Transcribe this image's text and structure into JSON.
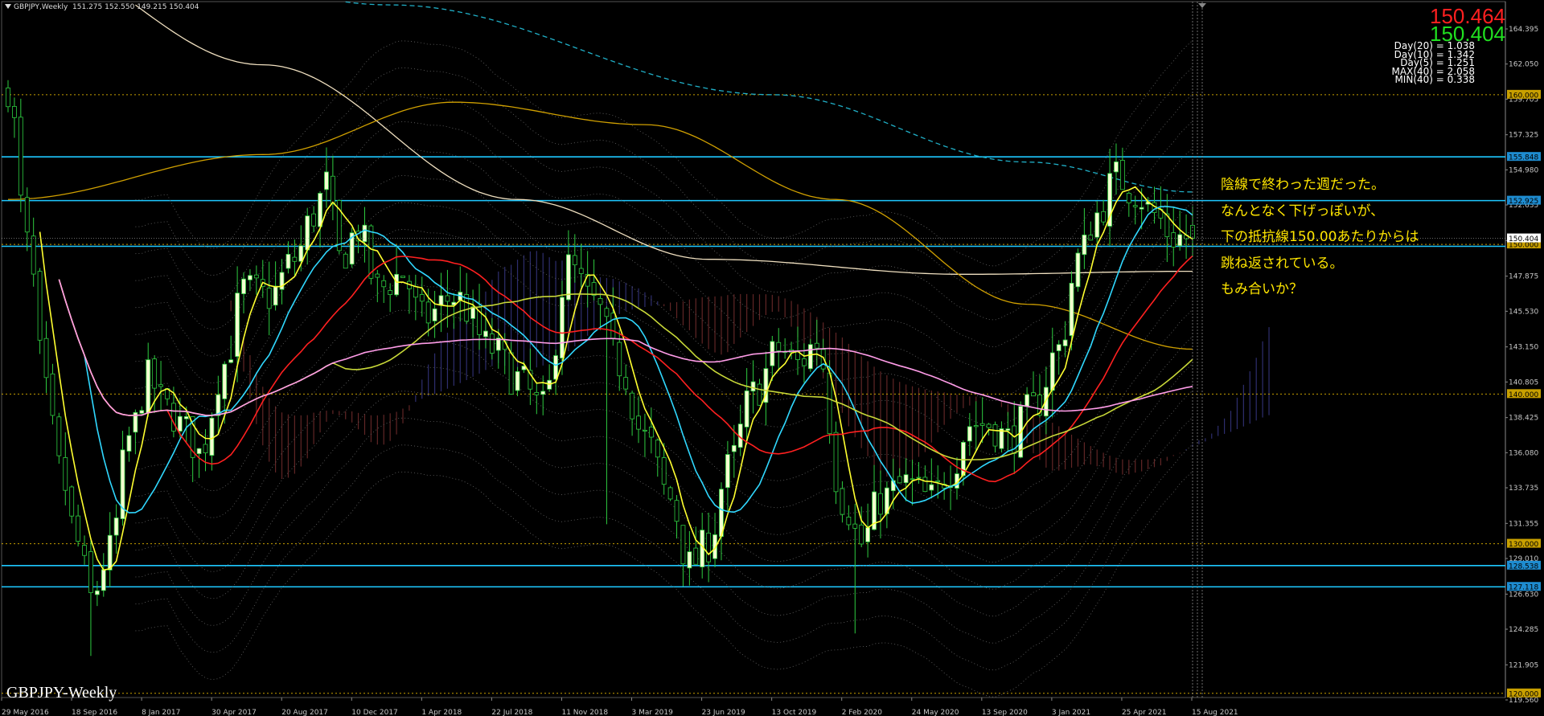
{
  "header": {
    "symbol": "GBPJPY,Weekly",
    "ohlc": "151.275 152.550 149.215 150.404"
  },
  "prices": {
    "ask": "150.464",
    "bid": "150.404"
  },
  "stats": [
    "Day(20) = 1.038",
    "Day(10) = 1.342",
    "Day(5) = 1.251",
    "MAX(40) = 2.058",
    "MIN(40) = 0.338"
  ],
  "annotation": [
    "陰線で終わった週だった。",
    "なんとなく下げっぽいが、",
    "下の抵抗線150.00あたりからは",
    "跳ね返されている。",
    "もみ合いか？"
  ],
  "watermark": "GBPJPY-Weekly",
  "chart_data": {
    "type": "candlestick",
    "y_axis_ticks": [
      "164.395",
      "162.050",
      "159.705",
      "157.325",
      "154.980",
      "152.635",
      "150.255",
      "147.875",
      "145.530",
      "143.150",
      "140.805",
      "138.425",
      "136.080",
      "133.735",
      "131.355",
      "129.010",
      "126.630",
      "124.285",
      "121.905",
      "119.560"
    ],
    "ylim": [
      119.56,
      164.395
    ],
    "x_axis_ticks": [
      "29 May 2016",
      "18 Sep 2016",
      "8 Jan 2017",
      "30 Apr 2017",
      "20 Aug 2017",
      "10 Dec 2017",
      "1 Apr 2018",
      "22 Jul 2018",
      "11 Nov 2018",
      "3 Mar 2019",
      "23 Jun 2019",
      "13 Oct 2019",
      "2 Feb 2020",
      "24 May 2020",
      "13 Sep 2020",
      "3 Jan 2021",
      "25 Apr 2021",
      "15 Aug 2021"
    ],
    "horizontal_lines": [
      {
        "value": 160.0,
        "label": "160.000",
        "color": "#c8a000"
      },
      {
        "value": 155.848,
        "label": "155.848",
        "color": "#1ec8ff"
      },
      {
        "value": 152.925,
        "label": "152.925",
        "color": "#1ec8ff"
      },
      {
        "value": 150.0,
        "label": "150.000",
        "color": "#c8a000"
      },
      {
        "value": 149.87,
        "label": "",
        "color": "#1ec8ff"
      },
      {
        "value": 140.0,
        "label": "140.000",
        "color": "#c8a000"
      },
      {
        "value": 130.0,
        "label": "130.000",
        "color": "#c8a000"
      },
      {
        "value": 128.538,
        "label": "128.538",
        "color": "#1ec8ff"
      },
      {
        "value": 127.118,
        "label": "127.118",
        "color": "#1ec8ff"
      },
      {
        "value": 120.0,
        "label": "120.000",
        "color": "#c8a000"
      }
    ],
    "current_price": {
      "value": 150.404,
      "label": "150.404"
    },
    "close_anchors": [
      [
        0,
        160.5
      ],
      [
        3,
        150
      ],
      [
        6,
        140
      ],
      [
        8,
        135
      ],
      [
        11,
        130
      ],
      [
        13,
        126.3
      ],
      [
        16,
        129.5
      ],
      [
        19,
        137
      ],
      [
        22,
        141
      ],
      [
        25,
        139
      ],
      [
        28,
        137.5
      ],
      [
        30,
        136
      ],
      [
        34,
        142
      ],
      [
        37,
        147
      ],
      [
        41,
        146.5
      ],
      [
        45,
        149
      ],
      [
        48,
        152
      ],
      [
        50,
        154
      ],
      [
        52,
        149
      ],
      [
        55,
        151
      ],
      [
        58,
        147
      ],
      [
        62,
        148
      ],
      [
        65,
        145
      ],
      [
        70,
        146.5
      ],
      [
        76,
        143
      ],
      [
        80,
        141
      ],
      [
        84,
        139
      ],
      [
        88,
        148.5
      ],
      [
        92,
        146
      ],
      [
        96,
        142
      ],
      [
        100,
        137
      ],
      [
        104,
        133
      ],
      [
        107,
        128.5
      ],
      [
        110,
        130
      ],
      [
        113,
        135
      ],
      [
        117,
        140
      ],
      [
        121,
        143
      ],
      [
        124,
        142
      ],
      [
        127,
        143.5
      ],
      [
        131,
        133
      ],
      [
        134,
        130
      ],
      [
        137,
        133
      ],
      [
        141,
        134
      ],
      [
        145,
        133
      ],
      [
        148,
        135
      ],
      [
        151,
        138
      ],
      [
        154,
        138
      ],
      [
        157,
        137
      ],
      [
        161,
        139
      ],
      [
        165,
        143
      ],
      [
        168,
        149
      ],
      [
        171,
        152
      ],
      [
        174,
        154.5
      ],
      [
        177,
        153.5
      ],
      [
        180,
        152
      ],
      [
        183,
        150.5
      ],
      [
        186,
        150.4
      ]
    ],
    "moving_averages": [
      {
        "name": "MA5",
        "color": "#ffff30",
        "period": 5
      },
      {
        "name": "MA13",
        "color": "#30d8ff",
        "period": 13
      },
      {
        "name": "MA26",
        "color": "#ff2020",
        "period": 26
      },
      {
        "name": "MA52",
        "color": "#c8d838",
        "period": 52
      },
      {
        "name": "MA100",
        "color": "#ff9ce8",
        "period": 100
      }
    ],
    "long_curves": [
      {
        "color": "#f0e0c0",
        "points": [
          [
            0,
            170
          ],
          [
            40,
            162
          ],
          [
            80,
            153
          ],
          [
            110,
            149
          ],
          [
            150,
            148
          ],
          [
            186,
            148.2
          ]
        ]
      },
      {
        "color": "#d0a000",
        "points": [
          [
            0,
            153
          ],
          [
            40,
            156
          ],
          [
            70,
            159.5
          ],
          [
            100,
            158
          ],
          [
            130,
            153
          ],
          [
            160,
            146
          ],
          [
            186,
            143
          ]
        ]
      },
      {
        "color": "#20b0c8",
        "dash": true,
        "points": [
          [
            0,
            172
          ],
          [
            60,
            166
          ],
          [
            120,
            160
          ],
          [
            160,
            155.5
          ],
          [
            186,
            153.5
          ]
        ]
      }
    ]
  }
}
